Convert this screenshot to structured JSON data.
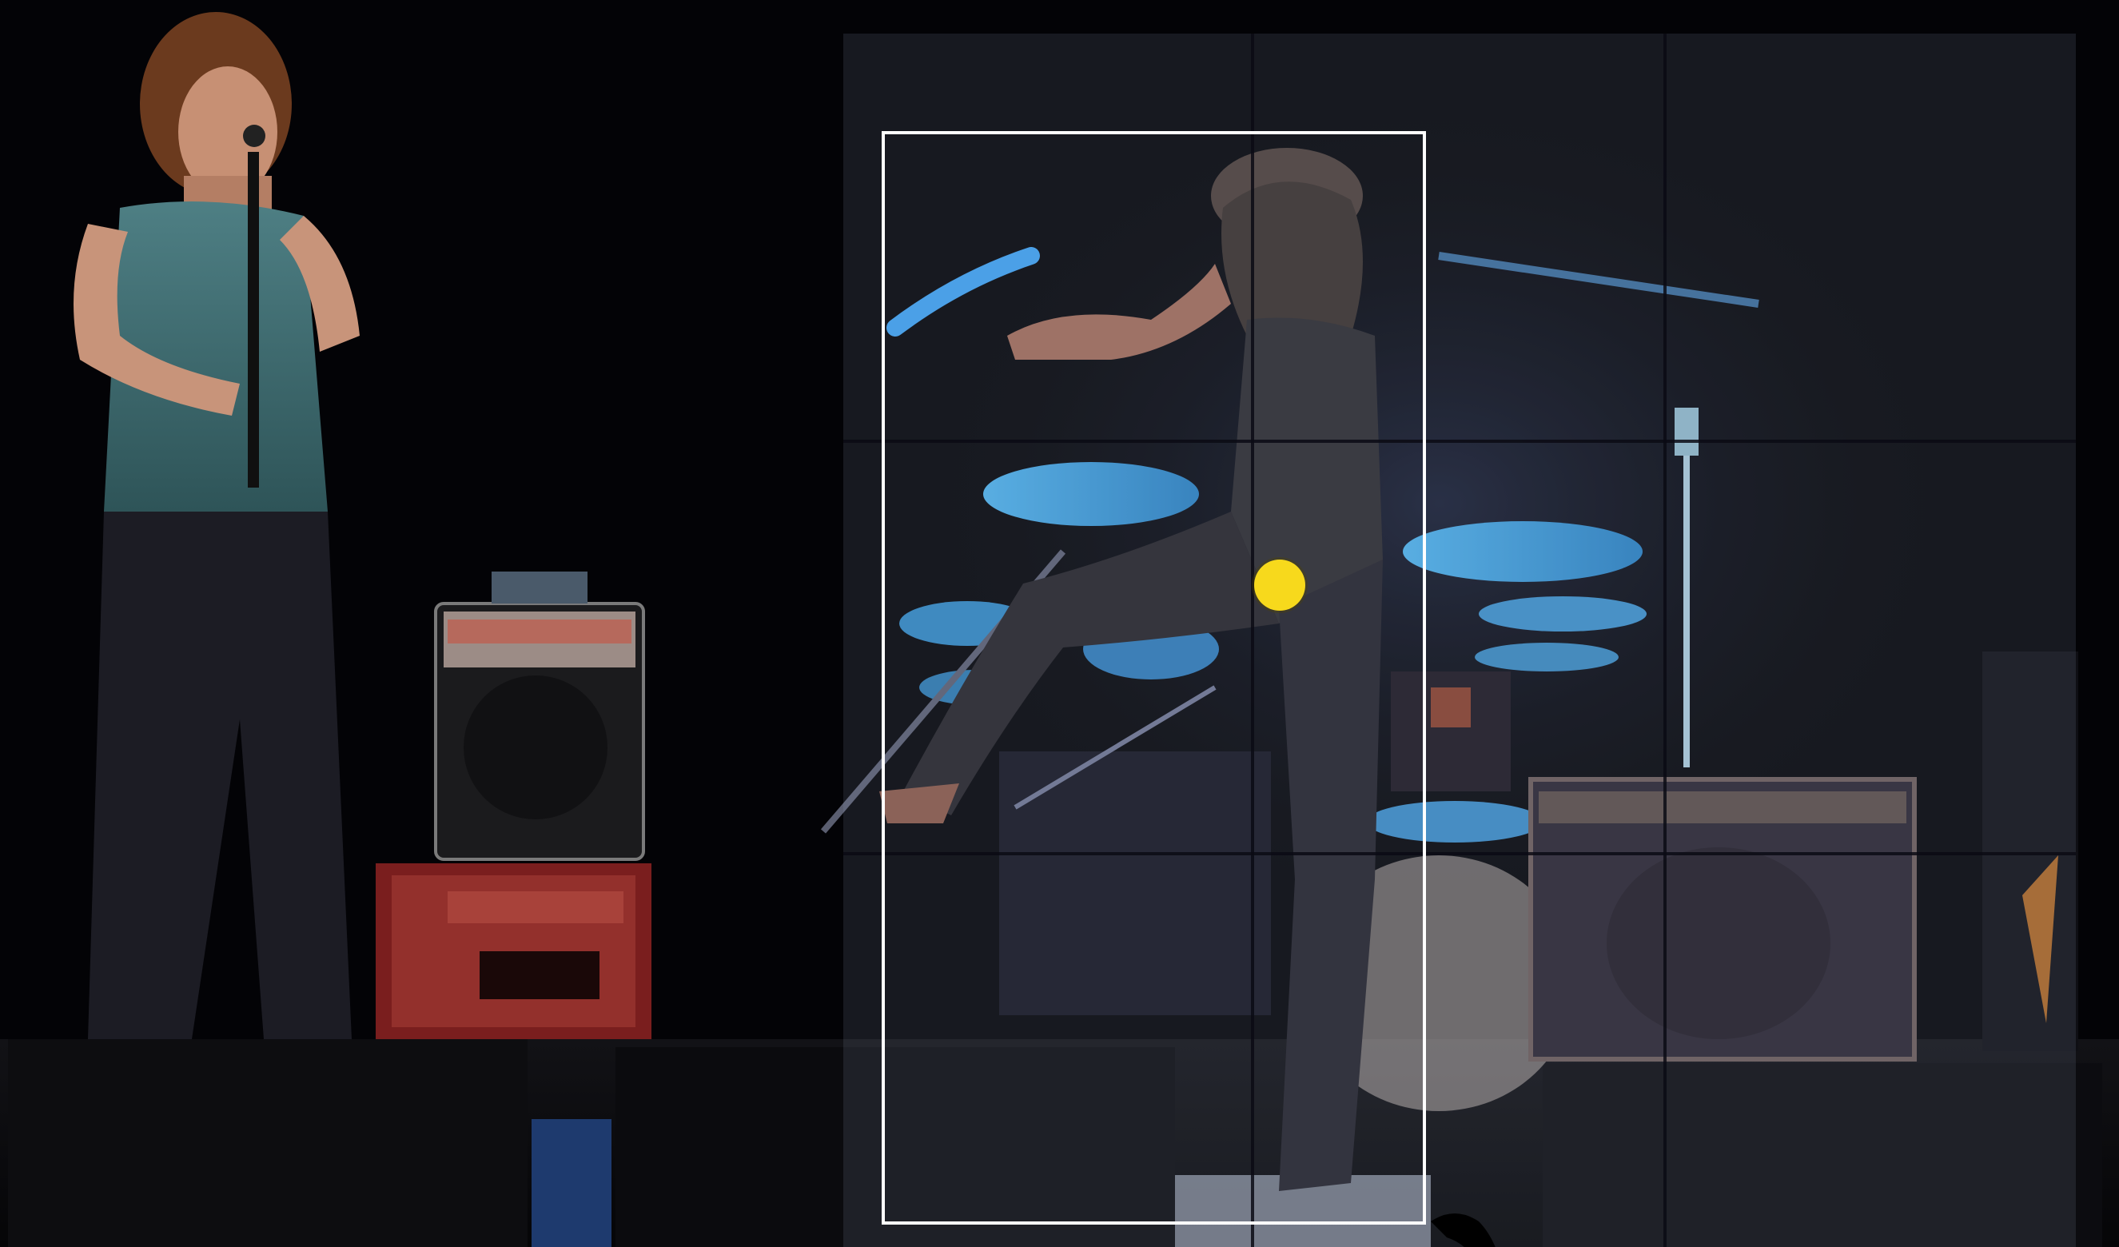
{
  "image": {
    "description_colors": {
      "overlay_tint": "#96a0be",
      "grid_line": "#0a0a14",
      "selection_border": "#ffffff",
      "center_marker": "#f7d91c",
      "stage_light_blue": "#3fa0e0"
    }
  },
  "annotation": {
    "grid_rows": 3,
    "grid_cols": 3,
    "has_selection_box": true,
    "has_center_marker": true
  }
}
